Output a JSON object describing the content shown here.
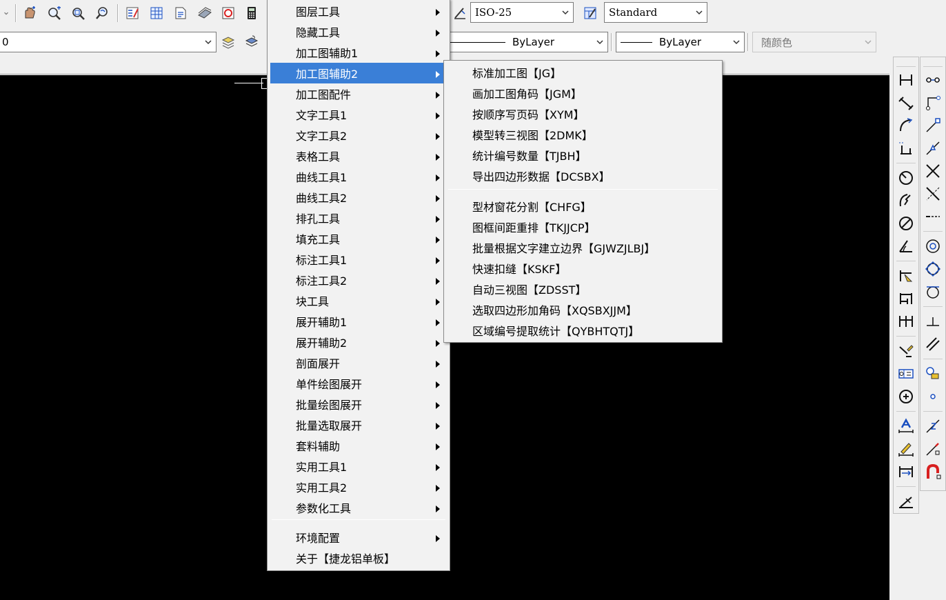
{
  "toolbar": {
    "dimstyle_value": "ISO-25",
    "tablestyle_value": "Standard",
    "layer_value": "0",
    "linetype_value": "ByLayer",
    "lineweight_value": "ByLayer",
    "plotstyle_value": "随颜色"
  },
  "main_menu": {
    "items": [
      {
        "label": "图层工具",
        "submenu": true
      },
      {
        "label": "隐藏工具",
        "submenu": true
      },
      {
        "label": "加工图辅助1",
        "submenu": true
      },
      {
        "label": "加工图辅助2",
        "submenu": true,
        "active": true
      },
      {
        "label": "加工图配件",
        "submenu": true
      },
      {
        "label": "文字工具1",
        "submenu": true
      },
      {
        "label": "文字工具2",
        "submenu": true
      },
      {
        "label": "表格工具",
        "submenu": true
      },
      {
        "label": "曲线工具1",
        "submenu": true
      },
      {
        "label": "曲线工具2",
        "submenu": true
      },
      {
        "label": "排孔工具",
        "submenu": true
      },
      {
        "label": "填充工具",
        "submenu": true
      },
      {
        "label": "标注工具1",
        "submenu": true
      },
      {
        "label": "标注工具2",
        "submenu": true
      },
      {
        "label": "块工具",
        "submenu": true
      },
      {
        "label": "展开辅助1",
        "submenu": true
      },
      {
        "label": "展开辅助2",
        "submenu": true
      },
      {
        "label": "剖面展开",
        "submenu": true
      },
      {
        "label": "单件绘图展开",
        "submenu": true
      },
      {
        "label": "批量绘图展开",
        "submenu": true
      },
      {
        "label": "批量选取展开",
        "submenu": true
      },
      {
        "label": "套料辅助",
        "submenu": true
      },
      {
        "label": "实用工具1",
        "submenu": true
      },
      {
        "label": "实用工具2",
        "submenu": true
      },
      {
        "label": "参数化工具",
        "submenu": true
      }
    ],
    "bottom_items": [
      {
        "label": "环境配置",
        "submenu": true
      },
      {
        "label": "关于【捷龙铝单板】",
        "submenu": false
      }
    ]
  },
  "sub_menu": {
    "group1": [
      "标准加工图【JG】",
      "画加工图角码【JGM】",
      "按顺序写页码【XYM】",
      "模型转三视图【2DMK】",
      "统计编号数量【TJBH】",
      "导出四边形数据【DCSBX】"
    ],
    "group2": [
      "型材窗花分割【CHFG】",
      "图框间距重排【TKJJCP】",
      "批量根据文字建立边界【GJWZJLBJ】",
      "快速扣缝【KSKF】",
      "自动三视图【ZDSST】",
      "选取四边形加角码【XQSBXJJM】",
      "区域编号提取统计【QYBHTQTJ】"
    ]
  },
  "colors": {
    "canvas": "#000000",
    "menu_bg": "#f2f2f2",
    "menu_highlight": "#3a7fd7",
    "toolbar_bg": "#f0f0f0"
  }
}
